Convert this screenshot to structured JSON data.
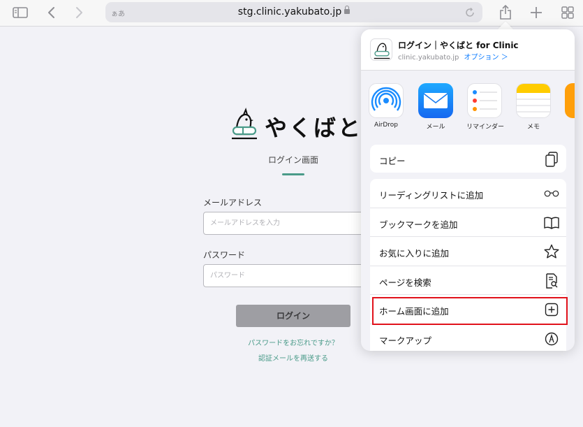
{
  "toolbar": {
    "address_aa": "ぁあ",
    "url": "stg.clinic.yakubato.jp"
  },
  "page": {
    "logo_text": "やくばと",
    "screen_title": "ログイン画面",
    "email_label": "メールアドレス",
    "email_placeholder": "メールアドレスを入力",
    "password_label": "パスワード",
    "password_placeholder": "パスワード",
    "login_button": "ログイン",
    "forgot_link": "パスワードをお忘れですか？",
    "resend_link": "認証メールを再送する",
    "accent_color": "#4a9b89"
  },
  "share_sheet": {
    "title": "ログイン｜やくばと for Clinic",
    "subtitle": "clinic.yakubato.jp",
    "options_label": "オプション ＞",
    "apps": [
      {
        "label": "AirDrop",
        "icon": "airdrop-icon"
      },
      {
        "label": "メール",
        "icon": "mail-icon"
      },
      {
        "label": "リマインダー",
        "icon": "reminders-icon"
      },
      {
        "label": "メモ",
        "icon": "notes-icon"
      },
      {
        "label": "",
        "icon": "app-icon"
      }
    ],
    "copy": {
      "label": "コピー",
      "icon": "copy-icon"
    },
    "actions": [
      {
        "label": "リーディングリストに追加",
        "icon": "glasses-icon"
      },
      {
        "label": "ブックマークを追加",
        "icon": "book-icon"
      },
      {
        "label": "お気に入りに追加",
        "icon": "star-icon"
      },
      {
        "label": "ページを検索",
        "icon": "find-in-page-icon"
      },
      {
        "label": "ホーム画面に追加",
        "icon": "add-square-icon"
      },
      {
        "label": "マークアップ",
        "icon": "markup-icon"
      }
    ],
    "highlight_color": "#e1121b"
  }
}
